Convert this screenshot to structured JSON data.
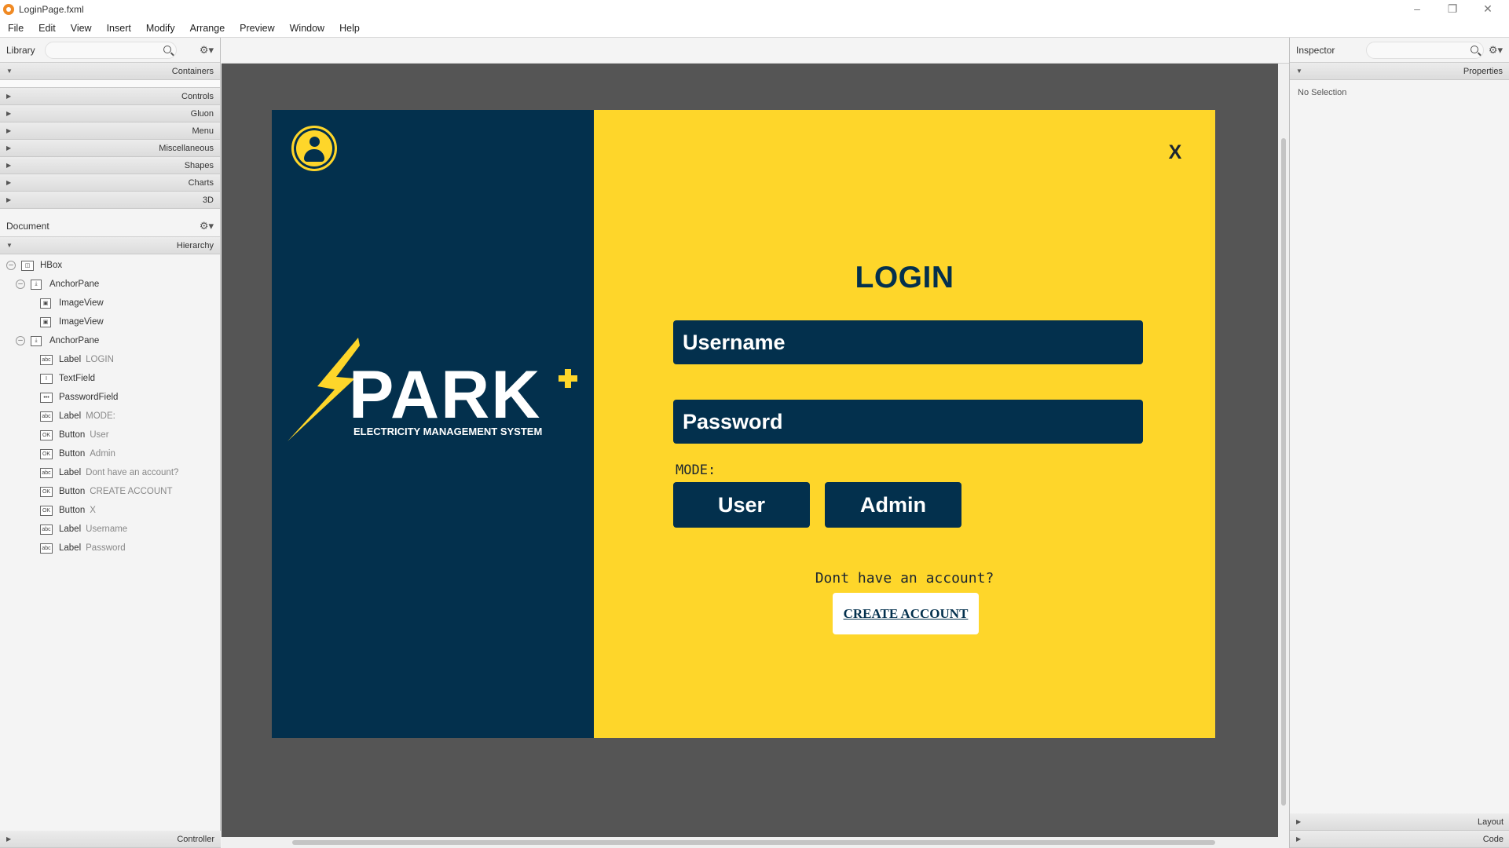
{
  "window": {
    "title": "LoginPage.fxml"
  },
  "menubar": [
    "File",
    "Edit",
    "View",
    "Insert",
    "Modify",
    "Arrange",
    "Preview",
    "Window",
    "Help"
  ],
  "library": {
    "title": "Library",
    "sections": {
      "containers": "Containers",
      "controls": "Controls",
      "gluon": "Gluon",
      "menu": "Menu",
      "miscellaneous": "Miscellaneous",
      "shapes": "Shapes",
      "charts": "Charts",
      "3d": "3D"
    }
  },
  "document": {
    "title": "Document",
    "hierarchy_label": "Hierarchy",
    "tree": [
      {
        "type": "HBox",
        "sub": "",
        "icon": "hbox"
      },
      {
        "type": "AnchorPane",
        "sub": "",
        "icon": "anchor"
      },
      {
        "type": "ImageView",
        "sub": "",
        "icon": "image"
      },
      {
        "type": "ImageView",
        "sub": "",
        "icon": "image"
      },
      {
        "type": "AnchorPane",
        "sub": "",
        "icon": "anchor"
      },
      {
        "type": "Label",
        "sub": "LOGIN",
        "icon": "label"
      },
      {
        "type": "TextField",
        "sub": "",
        "icon": "textfield"
      },
      {
        "type": "PasswordField",
        "sub": "",
        "icon": "password"
      },
      {
        "type": "Label",
        "sub": "MODE:",
        "icon": "label"
      },
      {
        "type": "Button",
        "sub": "User",
        "icon": "button"
      },
      {
        "type": "Button",
        "sub": "Admin",
        "icon": "button"
      },
      {
        "type": "Label",
        "sub": "Dont have an account?",
        "icon": "label"
      },
      {
        "type": "Button",
        "sub": "CREATE ACCOUNT",
        "icon": "button"
      },
      {
        "type": "Button",
        "sub": "X",
        "icon": "button"
      },
      {
        "type": "Label",
        "sub": "Username",
        "icon": "label"
      },
      {
        "type": "Label",
        "sub": "Password",
        "icon": "label"
      }
    ],
    "controller_label": "Controller"
  },
  "inspector": {
    "title": "Inspector",
    "properties_label": "Properties",
    "no_selection": "No Selection",
    "layout_label": "Layout",
    "code_label": "Code"
  },
  "login": {
    "close_label": "X",
    "title": "LOGIN",
    "username_label": "Username",
    "password_label": "Password",
    "mode_label": "MODE:",
    "user_button": "User",
    "admin_button": "Admin",
    "no_account_text": "Dont have an account?",
    "create_account_button": "CREATE ACCOUNT",
    "logo_text": "PARK",
    "logo_subtitle": "ELECTRICITY MANAGEMENT SYSTEM"
  },
  "colors": {
    "navy": "#03304d",
    "yellow": "#fed62a",
    "canvas": "#555555"
  }
}
